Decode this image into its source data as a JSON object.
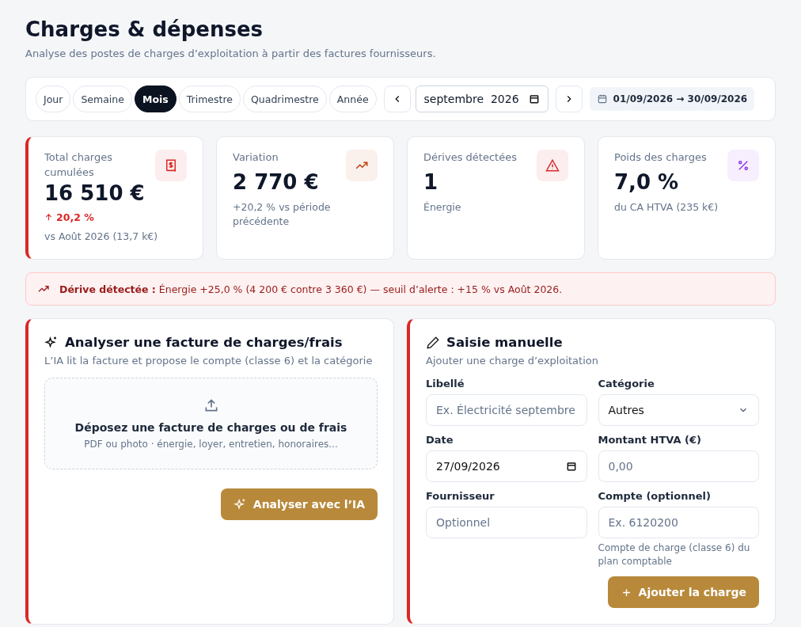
{
  "header": {
    "title": "Charges & dépenses",
    "subtitle": "Analyse des postes de charges d’exploitation à partir des factures fournisseurs."
  },
  "periods": [
    {
      "label": "Jour",
      "selected": false
    },
    {
      "label": "Semaine",
      "selected": false
    },
    {
      "label": "Mois",
      "selected": true
    },
    {
      "label": "Trimestre",
      "selected": false
    },
    {
      "label": "Quadrimestre",
      "selected": false
    },
    {
      "label": "Année",
      "selected": false
    }
  ],
  "month_picker": {
    "value": "septembre  2026"
  },
  "date_range": "01/09/2026 → 30/09/2026",
  "stats": [
    {
      "label": "Total charges cumulées",
      "value": "16 510 €",
      "change": "20,2 %",
      "note": "vs Août 2026 (13,7 k€)",
      "kind": "receipt",
      "color": "#dc2626",
      "accent": true
    },
    {
      "label": "Variation",
      "value": "2 770 €",
      "note": "+20,2 % vs période précédente",
      "kind": "trend",
      "color": "#c2410c",
      "accent": false
    },
    {
      "label": "Dérives détectées",
      "value": "1",
      "note": "Énergie",
      "kind": "alert",
      "color": "#dc2626",
      "accent": false
    },
    {
      "label": "Poids des charges",
      "value": "7,0 %",
      "note": "du CA HTVA (235 k€)",
      "kind": "percent",
      "color": "#9333ea",
      "accent": false
    }
  ],
  "alert": {
    "text": "**Dérive détectée :** Énergie +25,0 % (4 200 € contre 3 360 €) — seuil d’alerte : +15 % vs Août 2026."
  },
  "analyze_panel": {
    "title": "Analyser une facture de charges/frais",
    "subtitle": "L’IA lit la facture et propose le compte (classe 6) et la catégorie",
    "accent": true,
    "dropzone_title": "Déposez une facture de charges ou de frais",
    "dropzone_hint": "PDF ou photo · énergie, loyer, entretien, honoraires...",
    "button": "Analyser avec l’IA"
  },
  "manual_panel": {
    "title": "Saisie manuelle",
    "subtitle": "Ajouter une charge d’exploitation",
    "accent": true,
    "fields": [
      {
        "label": "Libellé",
        "kind": "text",
        "placeholder": "Ex. Électricité septembre"
      },
      {
        "label": "Catégorie",
        "kind": "select",
        "value": "Autres"
      },
      {
        "label": "Date",
        "kind": "date",
        "value": "27/09/2026"
      },
      {
        "label": "Montant HTVA (€)",
        "kind": "text",
        "placeholder": "0,00"
      },
      {
        "label": "Fournisseur",
        "kind": "text",
        "placeholder": "Optionnel"
      },
      {
        "label": "Compte (optionnel)",
        "kind": "text",
        "placeholder": "Ex. 6120200",
        "help": "Compte de charge (classe 6) du plan comptable"
      }
    ],
    "button": "Ajouter la charge"
  }
}
